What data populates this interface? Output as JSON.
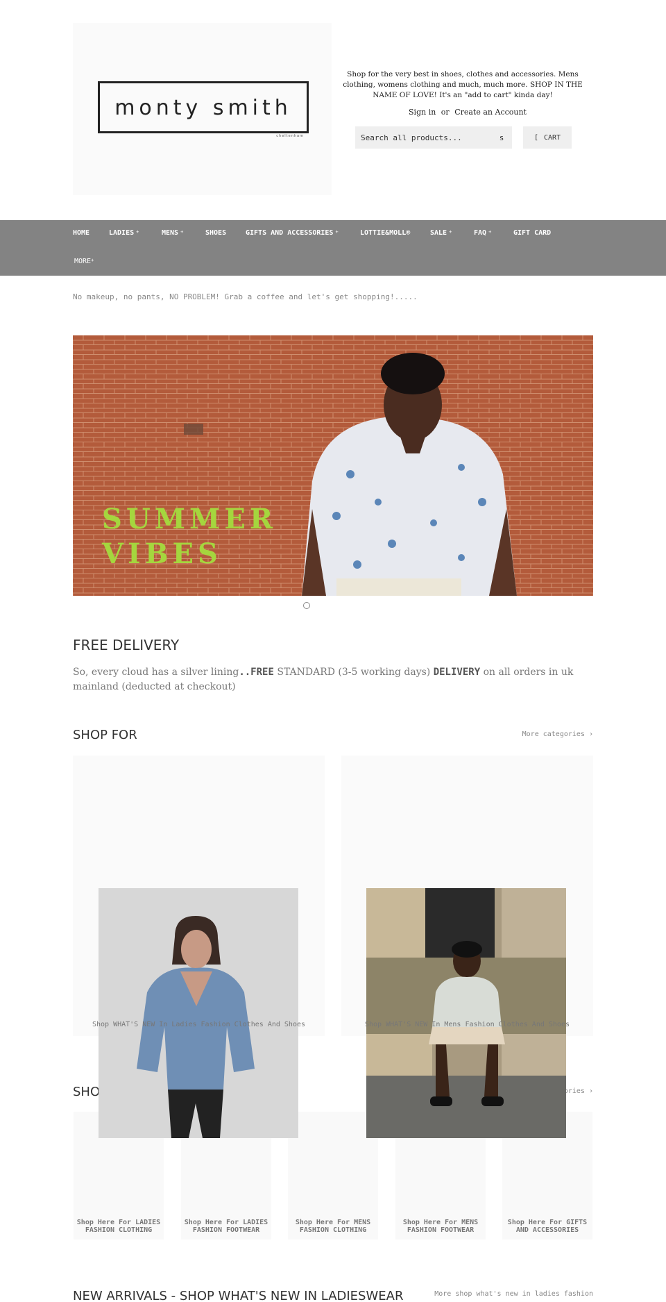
{
  "header": {
    "logo_text": "monty smith",
    "logo_sub": "cheltenham",
    "tagline": "Shop for the very best in shoes, clothes and accessories. Mens clothing, womens clothing and much, much more. SHOP IN THE NAME OF LOVE! It's an \"add to cart\" kinda day!",
    "sign_in": "Sign in",
    "or": "or",
    "create_account": "Create an Account",
    "search_placeholder": "Search all products...",
    "search_icon_glyph": "s",
    "cart_icon_glyph": "[",
    "cart_label": "CART"
  },
  "nav": {
    "items": [
      {
        "label": "HOME",
        "caret": ""
      },
      {
        "label": "LADIES",
        "caret": "+"
      },
      {
        "label": "MENS",
        "caret": "+"
      },
      {
        "label": "SHOES",
        "caret": ""
      },
      {
        "label": "GIFTS AND ACCESSORIES",
        "caret": "+"
      },
      {
        "label": "LOTTIE&MOLL®",
        "caret": ""
      },
      {
        "label": "SALE",
        "caret": "+"
      },
      {
        "label": "FAQ",
        "caret": "+"
      },
      {
        "label": "GIFT CARD",
        "caret": ""
      },
      {
        "label": "MORE",
        "caret": "+"
      }
    ]
  },
  "promo_text": "No makeup, no pants, NO PROBLEM! Grab a coffee and let's get shopping!.....",
  "hero": {
    "line1": "SUMMER",
    "line2": "VIBES"
  },
  "free_delivery": {
    "title": "FREE DELIVERY",
    "part1": "So, every cloud has a silver lining",
    "part2": "..FREE",
    "part3": " STANDARD (3-5 working days) ",
    "part4": "DELIVERY",
    "part5": " on all orders in uk mainland (deducted at checkout)"
  },
  "shop_for": {
    "title": "SHOP FOR",
    "more": "More categories ›",
    "cards": [
      {
        "caption": "Shop WHAT'S NEW In Ladies Fashion Clothes And Shoes"
      },
      {
        "caption": "Shop WHAT'S NEW In Mens Fashion Clothes And Shoes"
      }
    ]
  },
  "shop_second": {
    "title": "SHOP",
    "more": "More categories ›",
    "cards": [
      {
        "caption": "Shop Here For LADIES FASHION CLOTHING"
      },
      {
        "caption": "Shop Here For LADIES FASHION FOOTWEAR"
      },
      {
        "caption": "Shop Here For MENS FASHION CLOTHING"
      },
      {
        "caption": "Shop Here For MENS FASHION FOOTWEAR"
      },
      {
        "caption": "Shop Here For GIFTS AND ACCESSORIES"
      }
    ]
  },
  "new_arrivals": {
    "title": "NEW ARRIVALS - SHOP WHAT'S NEW IN LADIESWEAR",
    "more": "More shop what's new in ladies fashion"
  }
}
